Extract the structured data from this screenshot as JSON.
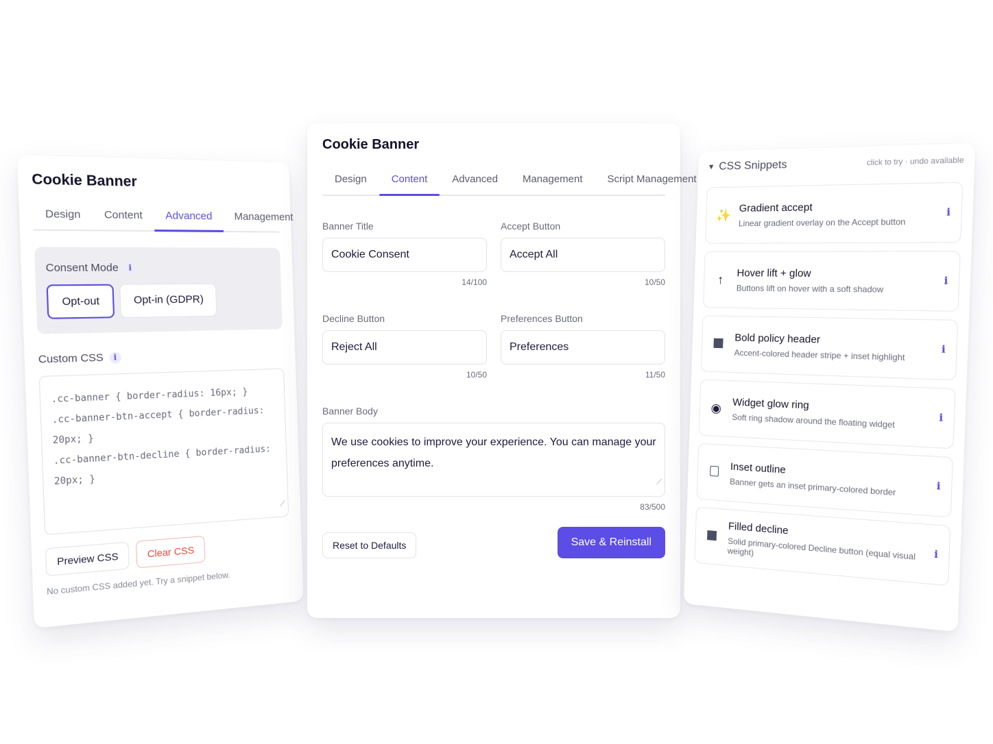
{
  "left": {
    "title": "Cookie Banner",
    "tabs": [
      {
        "label": "Design"
      },
      {
        "label": "Content"
      },
      {
        "label": "Advanced"
      },
      {
        "label": "Management"
      }
    ],
    "consent_mode": {
      "label": "Consent Mode",
      "options": [
        "Opt-out",
        "Opt-in (GDPR)"
      ],
      "selected": "Opt-out"
    },
    "custom_css": {
      "label": "Custom CSS",
      "lines": [
        ".cc-banner { border-radius: 16px; }",
        ".cc-banner-btn-accept { border-radius: 20px; }",
        ".cc-banner-btn-decline { border-radius: 20px; }"
      ],
      "preview_label": "Preview CSS",
      "clear_label": "Clear CSS",
      "hint": "No custom CSS added yet. Try a snippet below."
    }
  },
  "center": {
    "title": "Cookie Banner",
    "tabs": [
      {
        "label": "Design"
      },
      {
        "label": "Content"
      },
      {
        "label": "Advanced"
      },
      {
        "label": "Management"
      },
      {
        "label": "Script Management"
      }
    ],
    "fields": {
      "banner_title": {
        "label": "Banner Title",
        "value": "Cookie Consent",
        "counter": "14/100"
      },
      "accept_button": {
        "label": "Accept Button",
        "value": "Accept All",
        "counter": "10/50"
      },
      "decline_button": {
        "label": "Decline Button",
        "value": "Reject All",
        "counter": "10/50"
      },
      "preferences_button": {
        "label": "Preferences Button",
        "value": "Preferences",
        "counter": "11/50"
      },
      "banner_body": {
        "label": "Banner Body",
        "value": "We use cookies to improve your experience. You can manage your preferences anytime.",
        "counter": "83/500"
      }
    },
    "reset_label": "Reset to Defaults",
    "save_label": "Save & Reinstall"
  },
  "right": {
    "title": "CSS Snippets",
    "hint": "click to try · undo available",
    "snippets": [
      {
        "name": "Gradient accept",
        "desc": "Linear gradient overlay on the Accept button",
        "icon": "sparkle-icon"
      },
      {
        "name": "Hover lift + glow",
        "desc": "Buttons lift on hover with a soft shadow",
        "icon": "arrow-up-icon"
      },
      {
        "name": "Bold policy header",
        "desc": "Accent-colored header stripe + inset highlight",
        "icon": "square-icon"
      },
      {
        "name": "Widget glow ring",
        "desc": "Soft ring shadow around the floating widget",
        "icon": "radio-icon"
      },
      {
        "name": "Inset outline",
        "desc": "Banner gets an inset primary-colored border",
        "icon": "square-outline-icon"
      },
      {
        "name": "Filled decline",
        "desc": "Solid primary-colored Decline button (equal visual weight)",
        "icon": "square-icon"
      }
    ]
  },
  "colors": {
    "accent": "#5b4de6",
    "danger": "#e8473f",
    "sparkle": "#f2a43a"
  }
}
